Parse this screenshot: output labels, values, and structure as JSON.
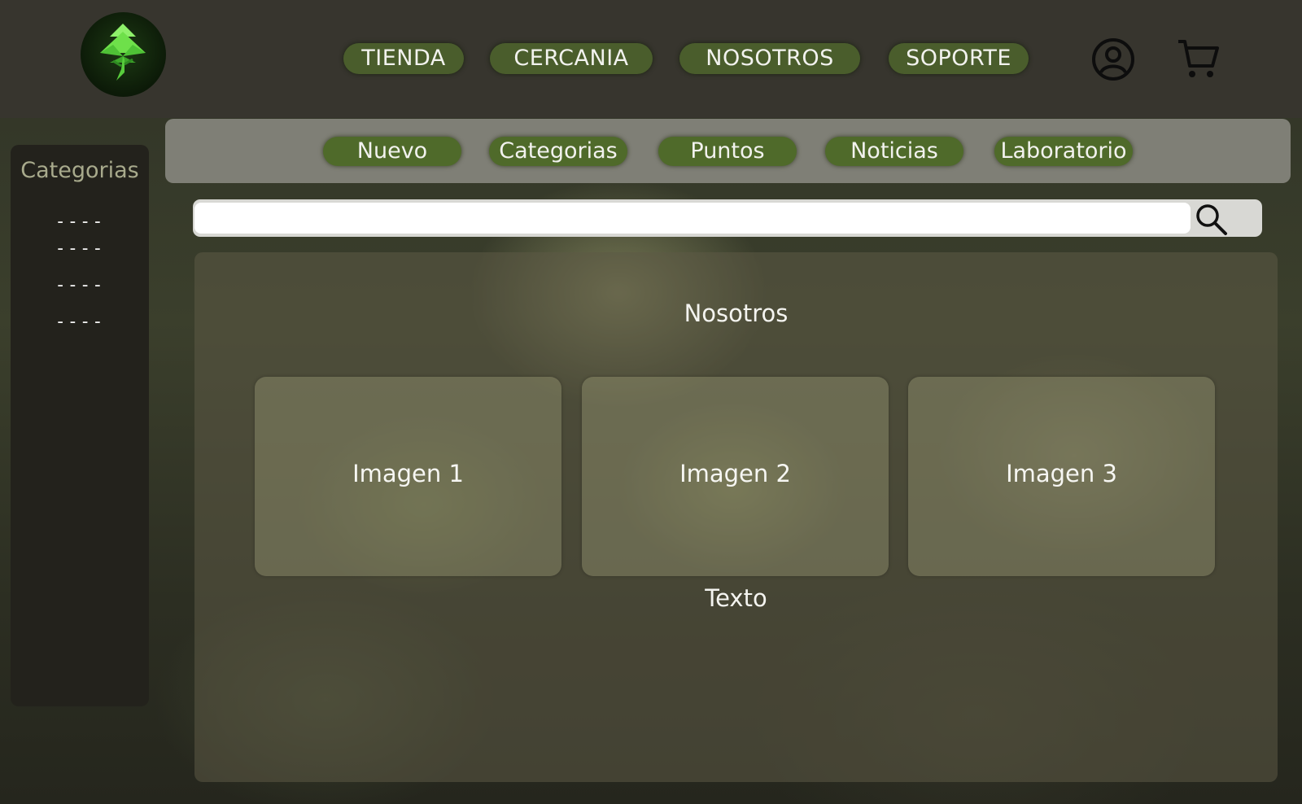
{
  "colors": {
    "topbar": "#37352e",
    "nav_pill": "#4a5d2c",
    "subbar": "#7f7f76",
    "sub_pill": "#4f6a2a",
    "sidebar": "#23221c",
    "logo_leaf": "#6ee04a"
  },
  "header": {
    "logo_icon": "tree-logo-icon",
    "nav": [
      {
        "label": "TIENDA"
      },
      {
        "label": "CERCANIA"
      },
      {
        "label": "NOSOTROS"
      },
      {
        "label": "SOPORTE"
      }
    ],
    "account_icon": "user-circle-icon",
    "cart_icon": "cart-icon"
  },
  "subnav": [
    {
      "label": "Nuevo"
    },
    {
      "label": "Categorias"
    },
    {
      "label": "Puntos"
    },
    {
      "label": "Noticias"
    },
    {
      "label": "Laboratorio"
    }
  ],
  "sidebar": {
    "title": "Categorias",
    "items": [
      "----",
      "----",
      "----",
      "----"
    ]
  },
  "search": {
    "value": "",
    "icon": "search-icon"
  },
  "main": {
    "title": "Nosotros",
    "cards": [
      {
        "label": "Imagen 1"
      },
      {
        "label": "Imagen 2"
      },
      {
        "label": "Imagen 3"
      }
    ],
    "text": "Texto"
  }
}
